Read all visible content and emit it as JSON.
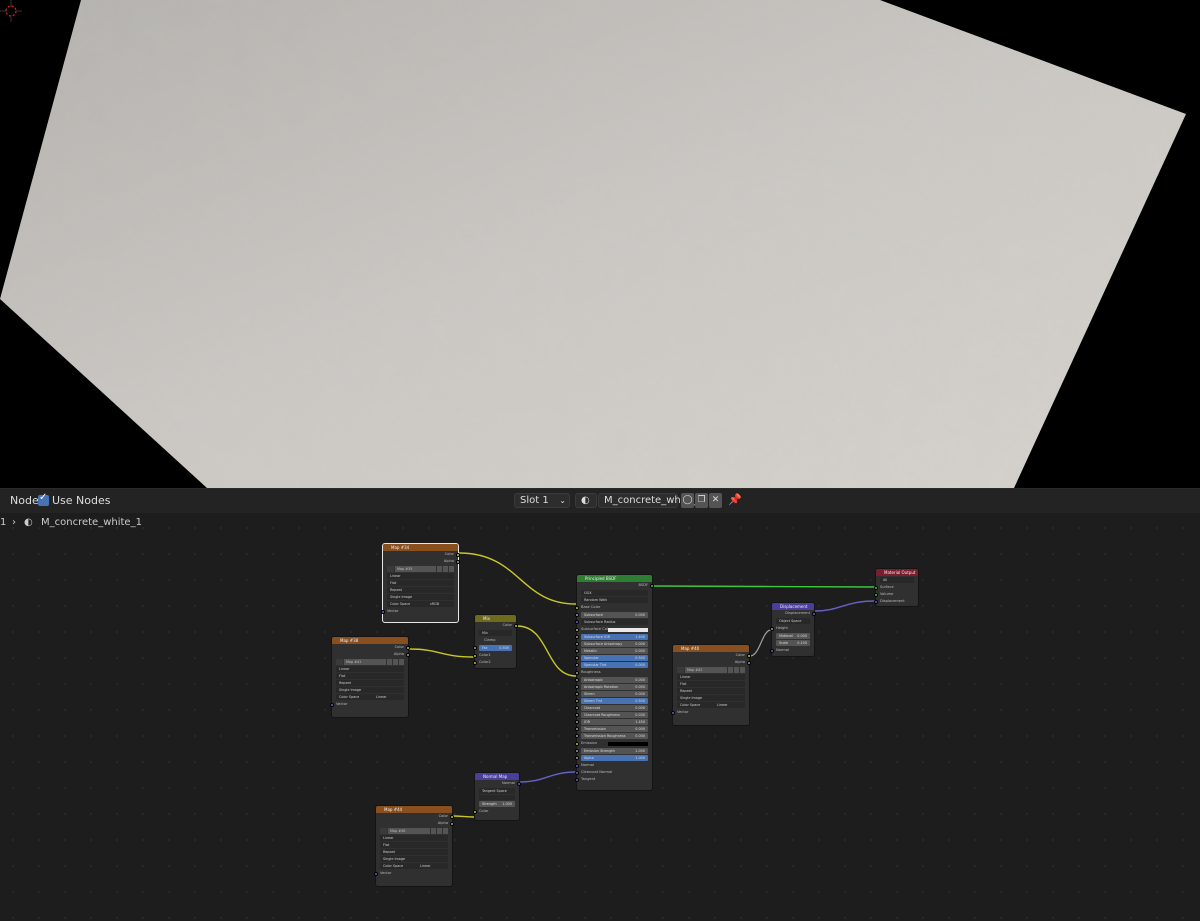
{
  "header": {
    "editor_label": "Node",
    "use_nodes_label": "Use Nodes",
    "slot": "Slot 1",
    "material_name": "M_concrete_white_1",
    "breadcrumb_index": "1",
    "breadcrumb_material": "M_concrete_white_1"
  },
  "icons": [
    "chevron-down-icon",
    "material-sphere-icon",
    "shield-icon",
    "copy-icon",
    "close-icon",
    "pin-icon",
    "chevron-right-icon",
    "3d-cursor-icon"
  ],
  "nodes": {
    "tex1": {
      "title": "Map #34",
      "image": "Map #35",
      "outs": [
        "Color",
        "Alpha"
      ],
      "dds": [
        "Linear",
        "Flat",
        "Repeat",
        "Single Image"
      ],
      "colorspace_label": "Color Space",
      "colorspace_val": "sRGB",
      "vector": "Vector"
    },
    "tex2": {
      "title": "Map #38",
      "image": "Map #41",
      "outs": [
        "Color",
        "Alpha"
      ],
      "dds": [
        "Linear",
        "Flat",
        "Repeat",
        "Single Image"
      ],
      "colorspace_label": "Color Space",
      "colorspace_val": "Linear",
      "vector": "Vector"
    },
    "mix": {
      "title": "Mix",
      "out": "Color",
      "dd": "Mix",
      "clamp": "Clamp",
      "fac": "Fac",
      "fac_val": "0.500",
      "c1": "Color1",
      "c2": "Color2"
    },
    "bsdf": {
      "title": "Principled BSDF",
      "out": "BSDF",
      "dd1": "GGX",
      "dd2": "Random Walk",
      "rows": [
        {
          "l": "Base Color",
          "t": "s"
        },
        {
          "l": "Subsurface",
          "v": "0.000",
          "t": "f"
        },
        {
          "l": "Subsurface Radius",
          "t": "d"
        },
        {
          "l": "Subsurface Color",
          "t": "c"
        },
        {
          "l": "Subsurface IOR",
          "v": "1.400",
          "t": "b"
        },
        {
          "l": "Subsurface Anisotropy",
          "v": "0.000",
          "t": "f"
        },
        {
          "l": "Metallic",
          "v": "0.000",
          "t": "f"
        },
        {
          "l": "Specular",
          "v": "0.500",
          "t": "b"
        },
        {
          "l": "Specular Tint",
          "v": "0.000",
          "t": "b"
        },
        {
          "l": "Roughness",
          "t": "s"
        },
        {
          "l": "Anisotropic",
          "v": "0.000",
          "t": "f"
        },
        {
          "l": "Anisotropic Rotation",
          "v": "0.000",
          "t": "f"
        },
        {
          "l": "Sheen",
          "v": "0.000",
          "t": "f"
        },
        {
          "l": "Sheen Tint",
          "v": "0.500",
          "t": "b"
        },
        {
          "l": "Clearcoat",
          "v": "0.000",
          "t": "f"
        },
        {
          "l": "Clearcoat Roughness",
          "v": "0.030",
          "t": "f"
        },
        {
          "l": "IOR",
          "v": "1.450",
          "t": "f"
        },
        {
          "l": "Transmission",
          "v": "0.000",
          "t": "f"
        },
        {
          "l": "Transmission Roughness",
          "v": "0.000",
          "t": "f"
        },
        {
          "l": "Emission",
          "t": "k"
        },
        {
          "l": "Emission Strength",
          "v": "1.000",
          "t": "f"
        },
        {
          "l": "Alpha",
          "v": "1.000",
          "t": "b"
        },
        {
          "l": "Normal",
          "t": "s"
        },
        {
          "l": "Clearcoat Normal",
          "t": "s"
        },
        {
          "l": "Tangent",
          "t": "s"
        }
      ]
    },
    "tex3": {
      "title": "Map #40",
      "image": "Map #42",
      "outs": [
        "Color",
        "Alpha"
      ],
      "dds": [
        "Linear",
        "Flat",
        "Repeat",
        "Single Image"
      ],
      "colorspace_label": "Color Space",
      "colorspace_val": "Linear",
      "vector": "Vector"
    },
    "disp": {
      "title": "Displacement",
      "out": "Displacement",
      "dd": "Object Space",
      "height": "Height",
      "mid": "Midlevel",
      "mid_val": "0.000",
      "scale": "Scale",
      "scale_val": "0.100",
      "normal": "Normal"
    },
    "out": {
      "title": "Material Output",
      "dd": "All",
      "ins": [
        "Surface",
        "Volume",
        "Displacement"
      ]
    },
    "nmap": {
      "title": "Normal Map",
      "out": "Normal",
      "dd": "Tangent Space",
      "strength": "Strength",
      "strength_val": "1.000",
      "color": "Color"
    },
    "tex4": {
      "title": "Map #44",
      "image": "Map #46",
      "outs": [
        "Color",
        "Alpha"
      ],
      "dds": [
        "Linear",
        "Flat",
        "Repeat",
        "Single Image"
      ],
      "colorspace_label": "Color Space",
      "colorspace_val": "Linear",
      "vector": "Vector"
    }
  }
}
